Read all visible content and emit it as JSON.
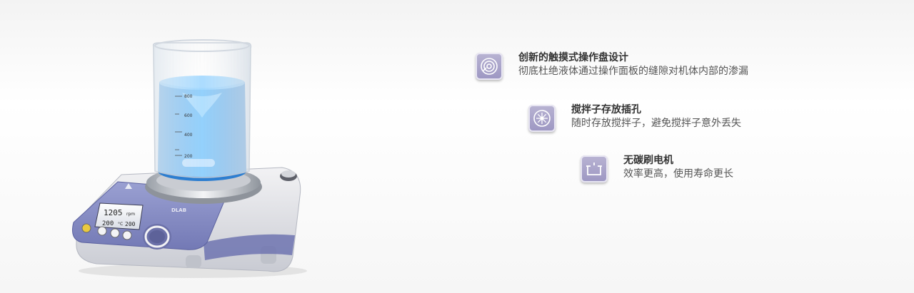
{
  "device": {
    "brand": "DLAB",
    "display": {
      "line1_value": "1205",
      "line1_unit": "rpm",
      "line2_value": "200",
      "line2_unit": "°C",
      "line2_right": "200"
    },
    "beaker_marks": [
      "800",
      "600",
      "400",
      "200"
    ]
  },
  "features": [
    {
      "icon": "touch-dial-icon",
      "title": "创新的触摸式操作盘设计",
      "desc": "彻底杜绝液体通过操作面板的缝隙对机体内部的渗漏"
    },
    {
      "icon": "stir-bar-storage-icon",
      "title": "搅拌子存放插孔",
      "desc": "随时存放搅拌子，避免搅拌子意外丢失"
    },
    {
      "icon": "brushless-motor-icon",
      "title": "无碳刷电机",
      "desc": "效率更高，使用寿命更长"
    }
  ],
  "colors": {
    "icon_bg": "#a39dc7",
    "liquid": "#3aa0ee",
    "panel": "#8d93c7"
  }
}
